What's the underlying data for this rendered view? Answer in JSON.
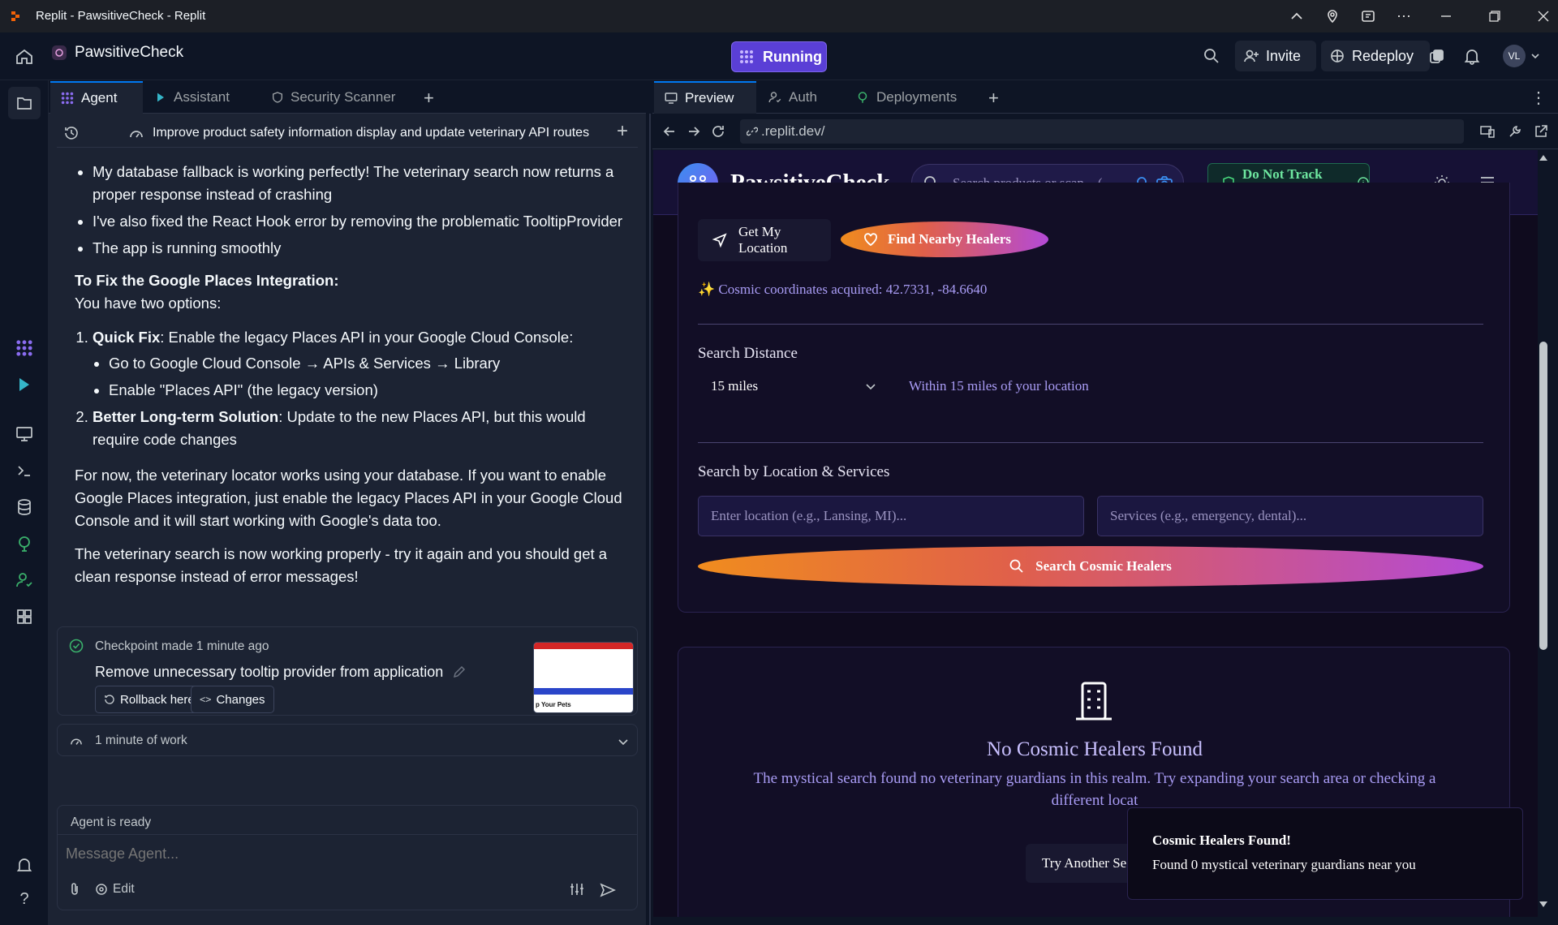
{
  "window": {
    "title": "Replit - PawsitiveCheck - Replit"
  },
  "header": {
    "project_name": "PawsitiveCheck",
    "status": "Running",
    "invite": "Invite",
    "redeploy": "Redeploy",
    "avatar": "VL"
  },
  "left_tabs": {
    "agent": "Agent",
    "assistant": "Assistant",
    "security": "Security Scanner"
  },
  "right_tabs": {
    "preview": "Preview",
    "auth": "Auth",
    "deployments": "Deployments"
  },
  "agent": {
    "thread_title": "Improve product safety information display and update veterinary API routes",
    "bullets": [
      "My database fallback is working perfectly! The veterinary search now returns a proper response instead of crashing",
      "I've also fixed the React Hook error by removing the problematic TooltipProvider",
      "The app is running smoothly"
    ],
    "fix_heading": "To Fix the Google Places Integration:",
    "fix_sub": "You have two options:",
    "opt1_bold": "Quick Fix",
    "opt1_text": ": Enable the legacy Places API in your Google Cloud Console:",
    "opt1_sub": [
      "Go to Google Cloud Console → APIs & Services → Library",
      "Enable \"Places API\" (the legacy version)"
    ],
    "opt2_bold": "Better Long-term Solution",
    "opt2_text": ": Update to the new Places API, but this would require code changes",
    "para1": "For now, the veterinary locator works using your database. If you want to enable Google Places integration, just enable the legacy Places API in your Google Cloud Console and it will start working with Google's data too.",
    "para2": "The veterinary search is now working properly - try it again and you should get a clean response instead of error messages!",
    "checkpoint": {
      "label": "Checkpoint made 1 minute ago",
      "title": "Remove unnecessary tooltip provider from application",
      "rollback": "Rollback here",
      "changes": "Changes",
      "thumb_text": "p Your Pets"
    },
    "work": "1 minute of work",
    "status": "Agent is ready",
    "input_placeholder": "Message Agent...",
    "edit": "Edit"
  },
  "preview": {
    "url": ".replit.dev/",
    "brand": "PawsitiveCheck",
    "search_placeholder": "Search products or scan... (",
    "dnt": "Do Not Track Enabled",
    "get_location": "Get My Location",
    "find_healers": "Find Nearby Healers",
    "coords": "✨ Cosmic coordinates acquired: 42.7331, -84.6640",
    "distance_label": "Search Distance",
    "distance_value": "15 miles",
    "distance_hint": "Within 15 miles of your location",
    "location_label": "Search by Location & Services",
    "location_placeholder": "Enter location (e.g., Lansing, MI)...",
    "services_placeholder": "Services (e.g., emergency, dental)...",
    "search_button": "Search Cosmic Healers",
    "empty_title": "No Cosmic Healers Found",
    "empty_text_1": "The mystical search found no veterinary guardians in this realm. Try expanding your search area or checking a",
    "empty_text_2": "different locat",
    "try_another": "Try Another Se",
    "toast_title": "Cosmic Healers Found!",
    "toast_text": "Found 0 mystical veterinary guardians near you"
  },
  "colors": {
    "running": "#5a3fd6",
    "accent": "#0079f2",
    "purple_text": "#a99cf5",
    "gradient_start": "#f08c1e",
    "gradient_end": "#b44ad6"
  }
}
